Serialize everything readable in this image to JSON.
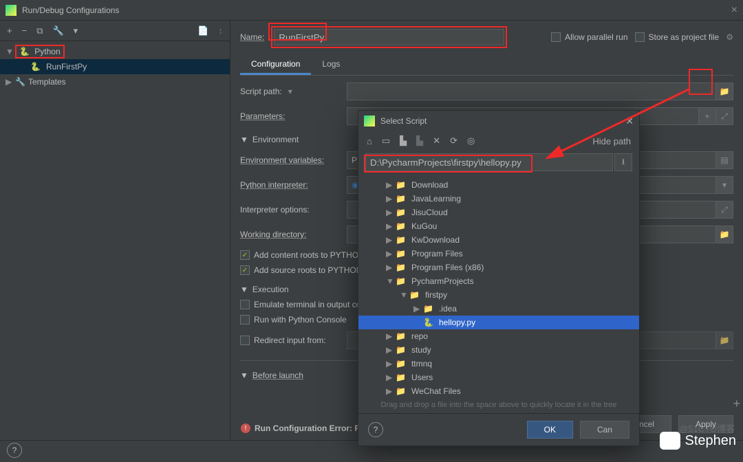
{
  "titlebar": {
    "title": "Run/Debug Configurations"
  },
  "sidebar": {
    "tools": [
      "+",
      "−",
      "⧉",
      "🔧",
      "▾",
      "",
      "📄",
      "↕"
    ],
    "nodes": {
      "python": "Python",
      "run_first": "RunFirstPy",
      "templates": "Templates"
    }
  },
  "header": {
    "name_label": "Name:",
    "name_value": "RunFirstPy",
    "allow_parallel": "Allow parallel run",
    "store_as": "Store as project file"
  },
  "tabs": {
    "config": "Configuration",
    "logs": "Logs"
  },
  "fields": {
    "script_path": "Script path:",
    "parameters": "Parameters:",
    "env_header": "Environment",
    "env_variables": "Environment variables:",
    "python_interpreter": "Python interpreter:",
    "interpreter_options": "Interpreter options:",
    "working_dir": "Working directory:",
    "content_roots": "Add content roots to PYTHONPATH",
    "source_roots": "Add source roots to PYTHONPATH",
    "exec_header": "Execution",
    "emulate": "Emulate terminal in output console",
    "run_console": "Run with Python Console",
    "redirect": "Redirect input from:",
    "before_launch": "Before launch"
  },
  "error": "Run Configuration Error: Pl",
  "footer": {
    "ok": "OK",
    "cancel": "Cancel",
    "apply": "Apply"
  },
  "modal": {
    "title": "Select Script",
    "hide_path": "Hide path",
    "path": "D:\\PycharmProjects\\firstpy\\hellopy.py",
    "tree": [
      {
        "ind": 1,
        "exp": "▶",
        "name": "Download",
        "type": "folder"
      },
      {
        "ind": 1,
        "exp": "▶",
        "name": "JavaLearning",
        "type": "folder"
      },
      {
        "ind": 1,
        "exp": "▶",
        "name": "JisuCloud",
        "type": "folder"
      },
      {
        "ind": 1,
        "exp": "▶",
        "name": "KuGou",
        "type": "folder"
      },
      {
        "ind": 1,
        "exp": "▶",
        "name": "KwDownload",
        "type": "folder"
      },
      {
        "ind": 1,
        "exp": "▶",
        "name": "Program Files",
        "type": "folder"
      },
      {
        "ind": 1,
        "exp": "▶",
        "name": "Program Files (x86)",
        "type": "folder"
      },
      {
        "ind": 1,
        "exp": "▼",
        "name": "PycharmProjects",
        "type": "folder"
      },
      {
        "ind": 2,
        "exp": "▼",
        "name": "firstpy",
        "type": "folder"
      },
      {
        "ind": 3,
        "exp": "▶",
        "name": ".idea",
        "type": "folder"
      },
      {
        "ind": 3,
        "exp": "",
        "name": "hellopy.py",
        "type": "py",
        "sel": true
      },
      {
        "ind": 1,
        "exp": "▶",
        "name": "repo",
        "type": "folder"
      },
      {
        "ind": 1,
        "exp": "▶",
        "name": "study",
        "type": "folder"
      },
      {
        "ind": 1,
        "exp": "▶",
        "name": "ttmnq",
        "type": "folder"
      },
      {
        "ind": 1,
        "exp": "▶",
        "name": "Users",
        "type": "folder"
      },
      {
        "ind": 1,
        "exp": "▶",
        "name": "WeChat Files",
        "type": "folder"
      }
    ],
    "hint": "Drag and drop a file into the space above to quickly locate it in the tree",
    "ok": "OK",
    "cancel": "Cancel"
  },
  "watermark": "Stephen",
  "faded_watermark": "@51CTO博客"
}
